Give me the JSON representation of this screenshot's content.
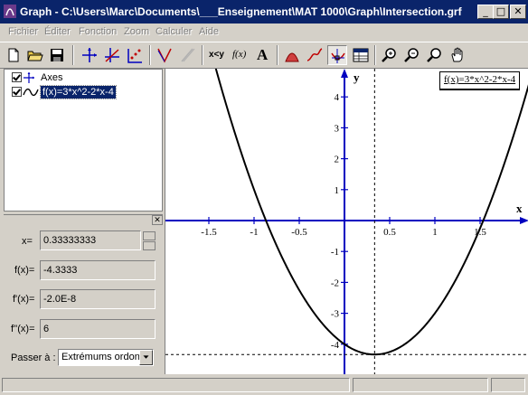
{
  "window": {
    "title": "Graph - C:\\Users\\Marc\\Documents\\___Enseignement\\MAT 1000\\Graph\\Intersection.grf",
    "minimize": "_",
    "maximize": "□",
    "close": "✕"
  },
  "menu": [
    "Fichier",
    "Éditer",
    "Fonction",
    "Zoom",
    "Calculer",
    "Aide"
  ],
  "toolbar": {
    "icons": [
      "new-file-icon",
      "open-folder-icon",
      "save-icon",
      "insert-axes-icon",
      "insert-function-icon",
      "insert-point-series-icon",
      "insert-tangent-icon",
      "insert-shading-icon",
      "x-equals-y-label",
      "f-of-x-label",
      "insert-label-icon",
      "shading-icon",
      "trendline-icon",
      "evaluate-icon",
      "table-icon",
      "zoom-in-icon",
      "zoom-out-icon",
      "zoom-window-icon",
      "move-hand-icon"
    ],
    "xy_label": "x<y",
    "fx_label": "f(x)",
    "text_label": "A"
  },
  "tree": {
    "items": [
      {
        "label": "Axes",
        "checked": true
      },
      {
        "label": "f(x)=3*x^2-2*x-4",
        "checked": true,
        "selected": true
      }
    ]
  },
  "panel": {
    "close": "✕",
    "x_label": "x=",
    "x_value": "0.33333333",
    "fx_label": "f(x)=",
    "fx_value": "-4.3333",
    "fpx_label": "f'(x)=",
    "fpx_value": "-2.0E-8",
    "fppx_label": "f''(x)=",
    "fppx_value": "6",
    "goto_label": "Passer à :",
    "goto_value": "Extrémums ordonnée"
  },
  "graph": {
    "legend": "f(x)=3*x^2-2*x-4",
    "x_axis_label": "x",
    "y_axis_label": "y",
    "x_ticks": [
      "-1.5",
      "-1",
      "-0.5",
      "0.5",
      "1",
      "1.5"
    ],
    "y_ticks": [
      "4",
      "3",
      "2",
      "1",
      "-1",
      "-2",
      "-3",
      "-4"
    ],
    "colors": {
      "axis": "#0000c0",
      "curve": "#000000"
    },
    "marker": {
      "x": 0.33333333,
      "y": -4.3333
    }
  }
}
